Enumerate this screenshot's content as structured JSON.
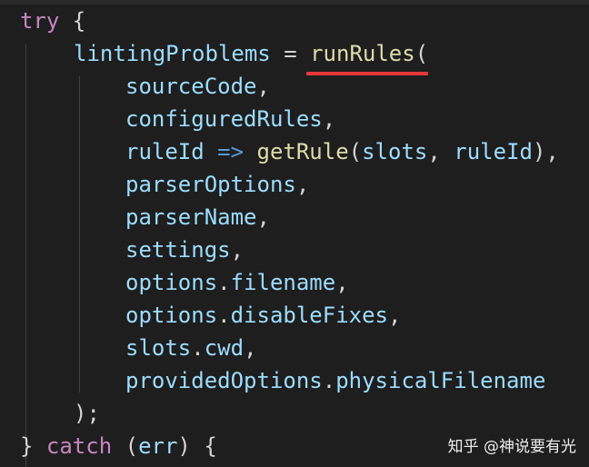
{
  "editor": {
    "lines": [
      {
        "id": "l1",
        "tokens": [
          {
            "t": "try",
            "c": "kw"
          },
          {
            "t": " {",
            "c": "br"
          }
        ]
      },
      {
        "id": "l2",
        "tokens": [
          {
            "t": "lintingProblems",
            "c": "var"
          },
          {
            "t": " = ",
            "c": "pun"
          },
          {
            "t": "runRules",
            "c": "fn"
          },
          {
            "t": "(",
            "c": "br"
          }
        ]
      },
      {
        "id": "l3",
        "tokens": [
          {
            "t": "sourceCode",
            "c": "var"
          },
          {
            "t": ",",
            "c": "pun"
          }
        ]
      },
      {
        "id": "l4",
        "tokens": [
          {
            "t": "configuredRules",
            "c": "var"
          },
          {
            "t": ",",
            "c": "pun"
          }
        ]
      },
      {
        "id": "l5",
        "tokens": [
          {
            "t": "ruleId",
            "c": "var"
          },
          {
            "t": " => ",
            "c": "op"
          },
          {
            "t": "getRule",
            "c": "fn"
          },
          {
            "t": "(",
            "c": "br"
          },
          {
            "t": "slots",
            "c": "var"
          },
          {
            "t": ", ",
            "c": "pun"
          },
          {
            "t": "ruleId",
            "c": "var"
          },
          {
            "t": "),",
            "c": "pun"
          }
        ]
      },
      {
        "id": "l6",
        "tokens": [
          {
            "t": "parserOptions",
            "c": "var"
          },
          {
            "t": ",",
            "c": "pun"
          }
        ]
      },
      {
        "id": "l7",
        "tokens": [
          {
            "t": "parserName",
            "c": "var"
          },
          {
            "t": ",",
            "c": "pun"
          }
        ]
      },
      {
        "id": "l8",
        "tokens": [
          {
            "t": "settings",
            "c": "var"
          },
          {
            "t": ",",
            "c": "pun"
          }
        ]
      },
      {
        "id": "l9",
        "tokens": [
          {
            "t": "options",
            "c": "var"
          },
          {
            "t": ".",
            "c": "pun"
          },
          {
            "t": "filename",
            "c": "var"
          },
          {
            "t": ",",
            "c": "pun"
          }
        ]
      },
      {
        "id": "l10",
        "tokens": [
          {
            "t": "options",
            "c": "var"
          },
          {
            "t": ".",
            "c": "pun"
          },
          {
            "t": "disableFixes",
            "c": "var"
          },
          {
            "t": ",",
            "c": "pun"
          }
        ]
      },
      {
        "id": "l11",
        "tokens": [
          {
            "t": "slots",
            "c": "var"
          },
          {
            "t": ".",
            "c": "pun"
          },
          {
            "t": "cwd",
            "c": "var"
          },
          {
            "t": ",",
            "c": "pun"
          }
        ]
      },
      {
        "id": "l12",
        "tokens": [
          {
            "t": "providedOptions",
            "c": "var"
          },
          {
            "t": ".",
            "c": "pun"
          },
          {
            "t": "physicalFilename",
            "c": "var"
          }
        ]
      },
      {
        "id": "l13",
        "tokens": [
          {
            "t": ");",
            "c": "pun"
          }
        ]
      },
      {
        "id": "l14",
        "tokens": [
          {
            "t": "} ",
            "c": "br"
          },
          {
            "t": "catch",
            "c": "kw"
          },
          {
            "t": " (",
            "c": "br"
          },
          {
            "t": "err",
            "c": "var"
          },
          {
            "t": ") {",
            "c": "br"
          }
        ]
      }
    ]
  },
  "watermark": {
    "text": "知乎 @神说要有光"
  },
  "colors": {
    "background": "#1e1e1e",
    "keyword": "#c586c0",
    "variable": "#9cdcfe",
    "function": "#dcdcaa",
    "operator": "#569cd6",
    "punctuation": "#d4d4d4",
    "highlight_underline": "#e5383b"
  }
}
